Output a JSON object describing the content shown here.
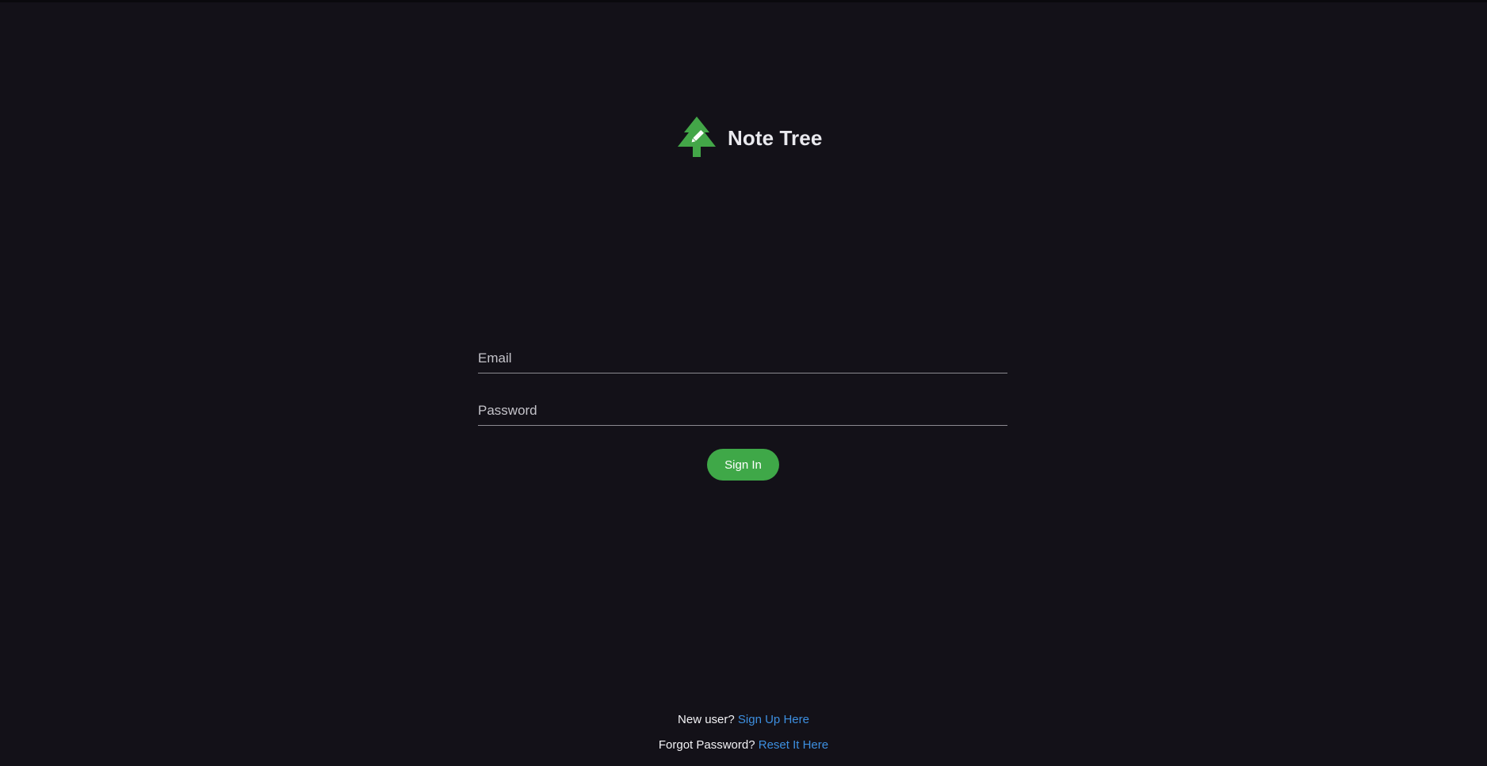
{
  "brand": {
    "name": "Note Tree",
    "logo_icon": "pine-tree-pencil-icon",
    "logo_color": "#43a648"
  },
  "form": {
    "email_placeholder": "Email",
    "email_value": "",
    "password_placeholder": "Password",
    "password_value": "",
    "submit_label": "Sign In",
    "submit_color": "#3fa848"
  },
  "footer": {
    "signup_prompt": "New user?",
    "signup_link": "Sign Up Here",
    "reset_prompt": "Forgot Password?",
    "reset_link": "Reset It Here",
    "link_color": "#3d8fe0"
  },
  "colors": {
    "background": "#131118",
    "text": "#e9e9ee"
  }
}
